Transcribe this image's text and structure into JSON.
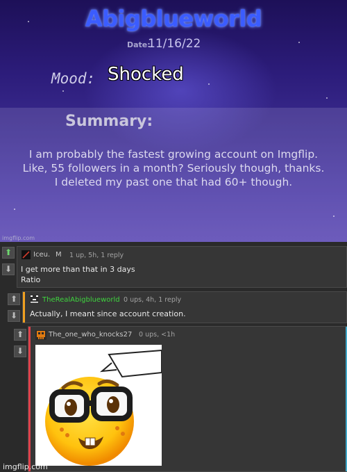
{
  "template": {
    "brand": "Abigblueworld",
    "date_label": "Date:",
    "date_value": "11/16/22",
    "mood_label": "Mood:",
    "mood_value": "Shocked",
    "summary_label": "Summary:",
    "summary_lines": [
      "I am probably the fastest growing account on Imgflip.",
      "Like, 55 followers in a month? Seriously though, thanks.",
      "I deleted my past one that had 60+ though."
    ],
    "watermark": "imgflip.com"
  },
  "comments": [
    {
      "username": "Iceu.",
      "user_badge": "M",
      "meta": "1 up, 5h, 1 reply",
      "text_lines": [
        "I get more than that in 3 days",
        "Ratio"
      ],
      "upvoted": true,
      "username_color": "#c9c9c9"
    },
    {
      "username": "TheRealAbigblueworld",
      "meta": "0 ups, 4h, 1 reply",
      "text_lines": [
        "Actually, I meant since account creation."
      ],
      "upvoted": false,
      "username_color": "#3fd43f",
      "bar_color": "#f0a020"
    },
    {
      "username": "The_one_who_knocks27",
      "meta": "0 ups, <1h",
      "upvoted": false,
      "username_color": "#c9c9c9",
      "bar_color": "#e0404a",
      "image_icon": "nerd-emoji-icon"
    }
  ],
  "footer_watermark": "imgflip.com",
  "icons": {
    "upvote": "arrow-up-icon",
    "downvote": "arrow-down-icon"
  },
  "colors": {
    "brand": "#3b5cff",
    "upvote_active": "#6ed86e"
  }
}
